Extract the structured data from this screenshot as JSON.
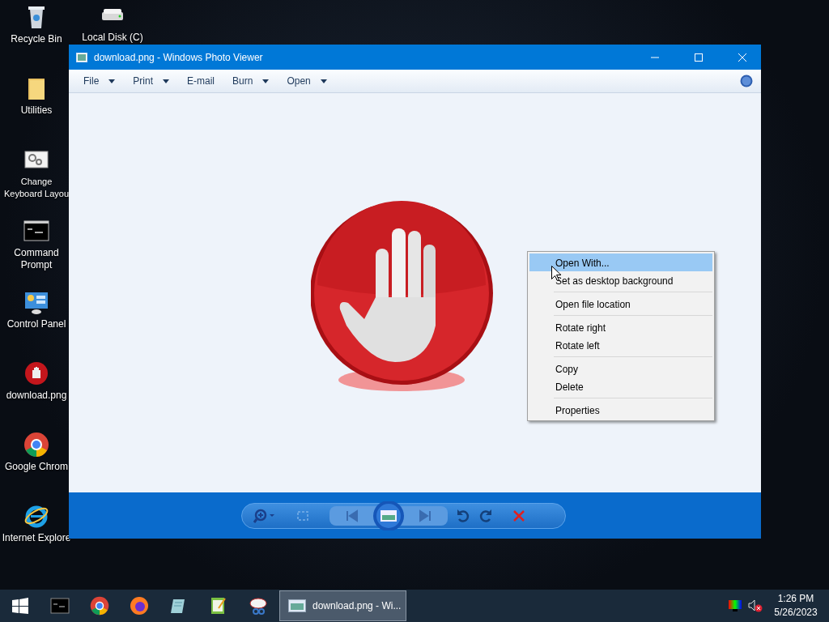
{
  "desktop_icons": [
    {
      "label": "Recycle Bin",
      "kind": "bin"
    },
    {
      "label": "Local Disk (C)",
      "kind": "disk"
    },
    {
      "label": "Utilities",
      "kind": "folder"
    },
    {
      "label": "Change Keyboard Layou",
      "kind": "settings"
    },
    {
      "label": "Command Prompt",
      "kind": "cmd"
    },
    {
      "label": "Control Panel",
      "kind": "panel"
    },
    {
      "label": "download.png",
      "kind": "stop"
    },
    {
      "label": "Google Chrom",
      "kind": "chrome"
    },
    {
      "label": "Internet Explore",
      "kind": "ie"
    }
  ],
  "window": {
    "title": "download.png - Windows Photo Viewer",
    "menu": [
      {
        "label": "File",
        "dropdown": true
      },
      {
        "label": "Print",
        "dropdown": true
      },
      {
        "label": "E-mail",
        "dropdown": false
      },
      {
        "label": "Burn",
        "dropdown": true
      },
      {
        "label": "Open",
        "dropdown": true
      }
    ]
  },
  "context_menu": [
    [
      {
        "label": "Open With...",
        "selected": true
      },
      {
        "label": "Set as desktop background",
        "selected": false
      }
    ],
    [
      {
        "label": "Open file location",
        "selected": false
      }
    ],
    [
      {
        "label": "Rotate right",
        "selected": false
      },
      {
        "label": "Rotate left",
        "selected": false
      }
    ],
    [
      {
        "label": "Copy",
        "selected": false
      },
      {
        "label": "Delete",
        "selected": false
      }
    ],
    [
      {
        "label": "Properties",
        "selected": false
      }
    ]
  ],
  "taskbar": {
    "active_window": "download.png - Wi...",
    "clock": {
      "time": "1:26 PM",
      "date": "5/26/2023"
    }
  }
}
